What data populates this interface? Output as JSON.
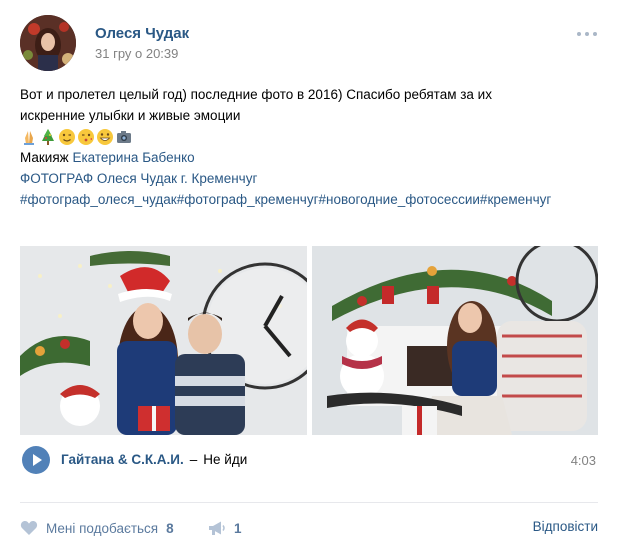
{
  "post": {
    "author": "Олеся Чудак",
    "date": "31 гру о 20:39",
    "text": {
      "line1": "Вот и пролетел целый год) последние фото в 2016) Спасибо ребятам за их",
      "line2": "искренние улыбки и живые эмоции",
      "emojis": [
        "folded-hands",
        "christmas-tree",
        "winking-face",
        "kissing-face",
        "grinning-face",
        "camera"
      ],
      "makeup_label": "Макияж",
      "makeup_link": "Екатерина Бабенко",
      "photographer_line": "ФОТОГРАФ Олеся Чудак г. Кременчуг",
      "hashtags": "#фотограф_олеся_чудак#фотограф_кременчуг#новогодние_фотосессии#кременчуг"
    },
    "photos": [
      {
        "name": "couple-christmas-photo"
      },
      {
        "name": "woman-christmas-photo"
      }
    ],
    "audio": {
      "artist": "Гайтана & С.К.А.И.",
      "separator": "–",
      "title": "Не йди",
      "duration": "4:03"
    },
    "footer": {
      "like_label": "Мені подобається",
      "like_count": "8",
      "share_count": "1",
      "reply_label": "Відповісти"
    }
  },
  "colors": {
    "link": "#2a5885",
    "muted": "#828282",
    "action": "#5b7a9e",
    "play_button": "#5181b8",
    "divider": "#e7e8ec"
  }
}
